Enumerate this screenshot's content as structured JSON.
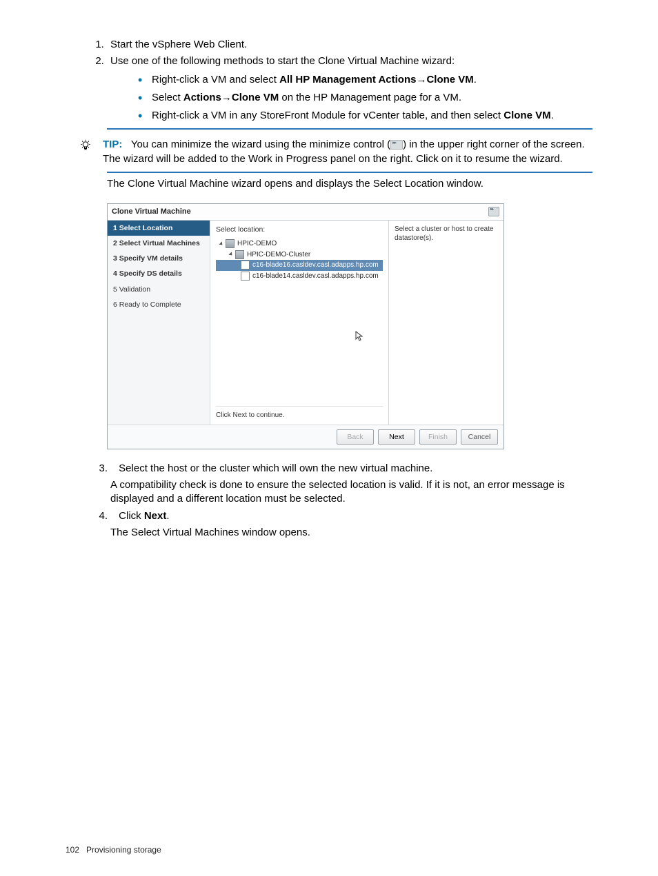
{
  "steps": {
    "s1": "Start the vSphere Web Client.",
    "s2_intro": "Use one of the following methods to start the Clone Virtual Machine wizard:",
    "s2_b1_a": "Right-click a VM and select ",
    "s2_b1_b": "All HP Management Actions",
    "s2_b1_arrow": "→",
    "s2_b1_c": "Clone VM",
    "s2_b1_d": ".",
    "s2_b2_a": "Select ",
    "s2_b2_b": "Actions",
    "s2_b2_arrow": "→",
    "s2_b2_c": "Clone VM",
    "s2_b2_d": " on the HP Management page for a VM.",
    "s2_b3_a": "Right-click a VM in any StoreFront Module for vCenter table, and then select ",
    "s2_b3_b": "Clone VM",
    "s2_b3_c": ".",
    "s3_a": "Select the host or the cluster which will own the new virtual machine.",
    "s3_b": "A compatibility check is done to ensure the selected location is valid. If it is not, an error message is displayed and a different location must be selected.",
    "s4_a": "Click ",
    "s4_b": "Next",
    "s4_c": ".",
    "s4_d": "The Select Virtual Machines window opens."
  },
  "tip": {
    "label": "TIP:",
    "text_a": "You can minimize the wizard using the minimize control (",
    "text_b": ") in the upper right corner of the screen. The wizard will be added to the Work in Progress panel on the right. Click on it to resume the wizard."
  },
  "after_tip": "The Clone Virtual Machine wizard opens and displays the Select Location window.",
  "wizard": {
    "title": "Clone Virtual Machine",
    "nav": {
      "n1": "1 Select Location",
      "n2": "2 Select Virtual Machines",
      "n3": "3 Specify VM details",
      "n4": "4 Specify DS details",
      "n5": "5 Validation",
      "n6": "6 Ready to Complete"
    },
    "content": {
      "label": "Select location:",
      "tree": {
        "dc": "HPIC-DEMO",
        "cluster": "HPIC-DEMO-Cluster",
        "host1": "c16-blade16.casldev.casl.adapps.hp.com",
        "host2": "c16-blade14.casldev.casl.adapps.hp.com"
      },
      "hint": "Click Next to continue.",
      "right": "Select a cluster or host to create datastore(s)."
    },
    "buttons": {
      "back": "Back",
      "next": "Next",
      "finish": "Finish",
      "cancel": "Cancel"
    }
  },
  "footer": {
    "page": "102",
    "section": "Provisioning storage"
  }
}
